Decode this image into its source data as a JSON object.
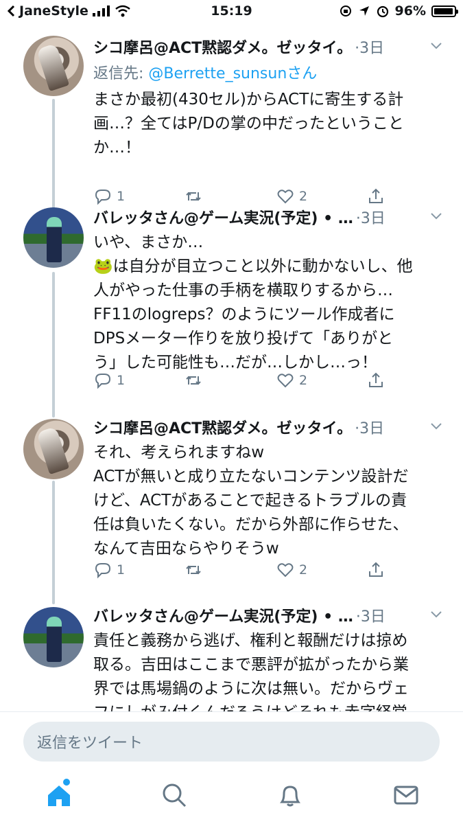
{
  "status_bar": {
    "carrier": "JaneStyle",
    "time": "15:19",
    "battery": "96%"
  },
  "tweets": [
    {
      "name": "シコ摩呂@ACT黙認ダメ。ゼッタイ。",
      "time": "·3日",
      "reply_prefix": "返信先: ",
      "reply_handle": "@Berrette_sunsunさん",
      "text": "まさか最初(430セル)からACTに寄生する計\n画…？全てはP/Dの掌の中だったということ\nか…！",
      "reply_count": "1",
      "retweet_count": "",
      "like_count": "2",
      "avatar": "cat-avatar"
    },
    {
      "name": "バレッタさん@ゲーム実況(予定) • …",
      "time": "·3日",
      "text": "いや、まさか…\n🐸は自分が目立つこと以外に動かないし、他\n人がやった仕事の手柄を横取りするから…\nFF11のlogreps？のようにツール作成者に\nDPSメーター作りを放り投げて「ありがと\nう」した可能性も…だが…しかし…っ！",
      "reply_count": "1",
      "retweet_count": "",
      "like_count": "2",
      "avatar": "game-avatar"
    },
    {
      "name": "シコ摩呂@ACT黙認ダメ。ゼッタイ。",
      "time": "·3日",
      "text": "それ、考えられますねw\nACTが無いと成り立たないコンテンツ設計だ\nけど、ACTがあることで起きるトラブルの責\n任は負いたくない。だから外部に作らせた、\nなんて吉田ならやりそうw",
      "reply_count": "1",
      "retweet_count": "",
      "like_count": "2",
      "avatar": "cat-avatar"
    },
    {
      "name": "バレッタさん@ゲーム実況(予定) • …",
      "time": "·3日",
      "text": "責任と義務から逃げ、権利と報酬だけは掠め\n取る。吉田はここまで悪評が拡がったから業\n界では馬場鍋のように次は無い。だからヴェ\nフにしがみ付くんだろうけどそれも赤字経営",
      "avatar": "game-avatar"
    }
  ],
  "reply_box": {
    "placeholder": "返信をツイート"
  },
  "tabs": [
    "home-icon",
    "search-icon",
    "notifications-icon",
    "messages-icon"
  ],
  "colors": {
    "accent": "#1da1f2",
    "secondary_text": "#657786",
    "thread_line": "#c4cfd6"
  }
}
